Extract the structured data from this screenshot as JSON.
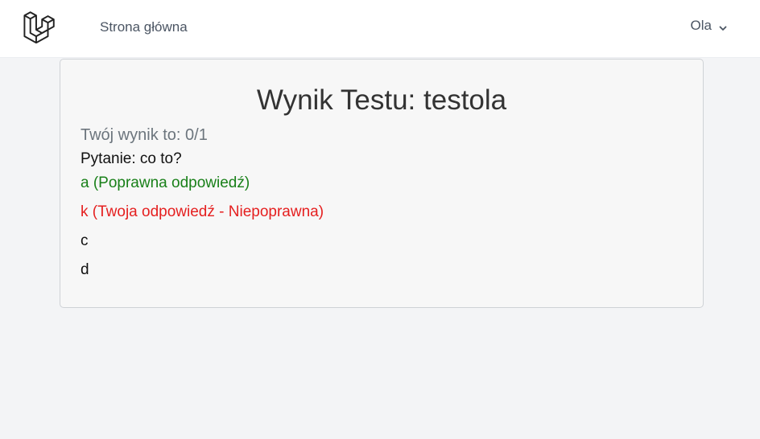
{
  "nav": {
    "home_label": "Strona główna",
    "user_name": "Ola",
    "logo_icon": "laravel-logo-icon",
    "dropdown_icon": "chevron-down-icon"
  },
  "result": {
    "title": "Wynik Testu: testola",
    "score": "Twój wynik to: 0/1",
    "question": "Pytanie: co to?",
    "answers": [
      {
        "text": "a (Poprawna odpowiedź)",
        "status": "correct"
      },
      {
        "text": "k (Twoja odpowiedź - Niepoprawna)",
        "status": "wrong"
      },
      {
        "text": "c",
        "status": "neutral"
      },
      {
        "text": "d",
        "status": "neutral"
      }
    ]
  },
  "colors": {
    "correct": "#198019",
    "wrong": "#e51f1f",
    "background": "#f3f4f6",
    "card": "#f7f7f7"
  }
}
